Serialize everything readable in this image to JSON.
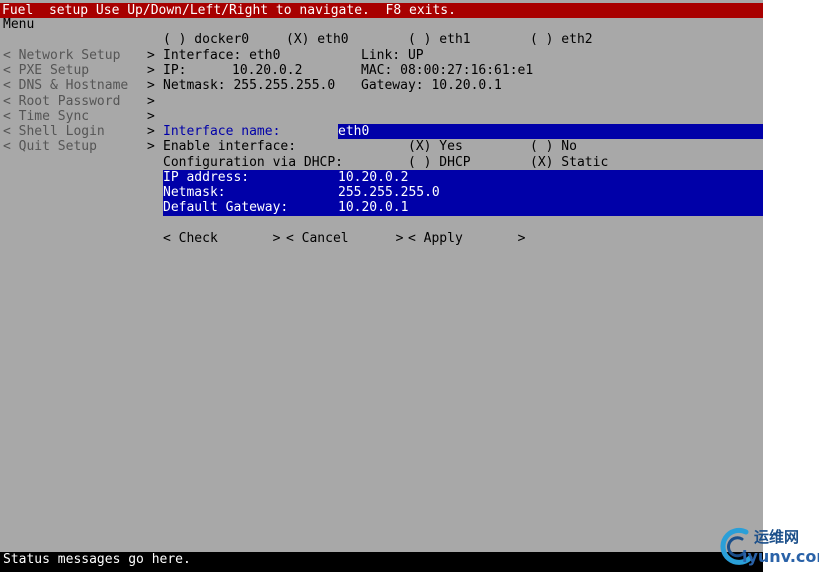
{
  "title": "Fuel  setup Use Up/Down/Left/Right to navigate.  F8 exits.",
  "menu_label": "Menu",
  "sidebar": {
    "items": [
      {
        "label": "< Network Setup",
        "arrow": ">"
      },
      {
        "label": "< PXE Setup",
        "arrow": ">"
      },
      {
        "label": "< DNS & Hostname",
        "arrow": ">"
      },
      {
        "label": "< Root Password",
        "arrow": ">"
      },
      {
        "label": "< Time Sync",
        "arrow": ">"
      },
      {
        "label": "< Shell Login",
        "arrow": ">"
      },
      {
        "label": "< Quit Setup",
        "arrow": ">"
      }
    ]
  },
  "interfaces": [
    {
      "label": "( ) docker0"
    },
    {
      "label": "(X) eth0"
    },
    {
      "label": "( ) eth1"
    },
    {
      "label": "( ) eth2"
    }
  ],
  "info": {
    "interface": "Interface: eth0",
    "link": "Link: UP",
    "ip_label": "IP:",
    "ip_value": "10.20.0.2",
    "mac": "MAC: 08:00:27:16:61:e1",
    "netmask": "Netmask: 255.255.255.0",
    "gateway": "Gateway: 10.20.0.1"
  },
  "form": {
    "interface_name_label": "Interface name:",
    "interface_name_value": "eth0",
    "enable_label": "Enable interface:",
    "enable_yes": "(X) Yes",
    "enable_no": "( ) No",
    "dhcp_label": "Configuration via DHCP:",
    "dhcp_option": "( ) DHCP",
    "static_option": "(X) Static",
    "ip_label": "IP address:",
    "ip_value": "10.20.0.2",
    "netmask_label": "Netmask:",
    "netmask_value": "255.255.255.0",
    "gateway_label": "Default Gateway:",
    "gateway_value": "10.20.0.1"
  },
  "buttons": {
    "check": "< Check       >",
    "cancel": "< Cancel      >",
    "apply": "< Apply       >"
  },
  "status": "Status messages go here.",
  "watermark": {
    "cn": "运维网",
    "en": "iyunv.com"
  },
  "colors": {
    "background": "#a8a8a8",
    "titlebar": "#a80000",
    "highlight": "#0000a8",
    "statusbar": "#000000"
  }
}
